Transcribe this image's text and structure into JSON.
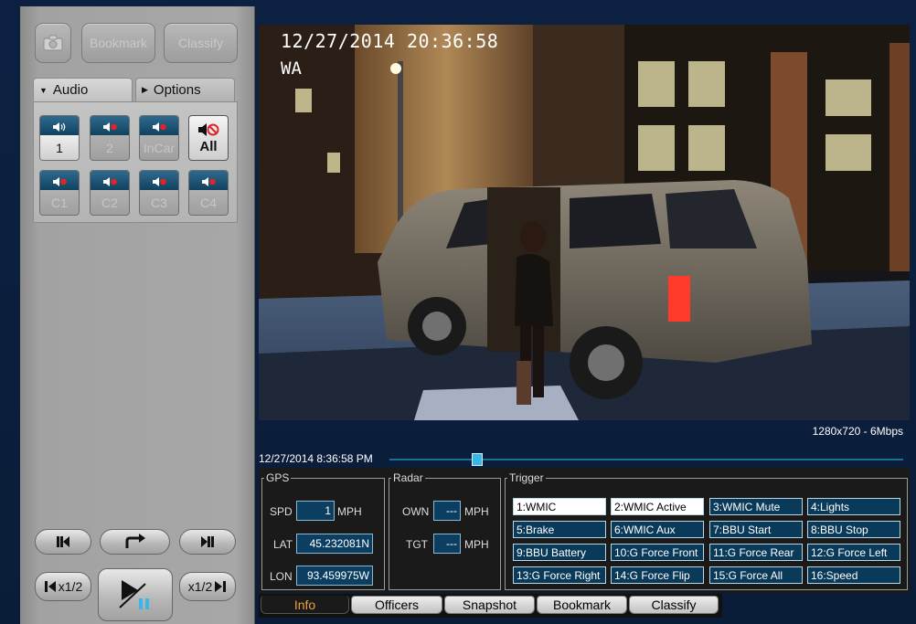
{
  "toolbar": {
    "bookmark_label": "Bookmark",
    "classify_label": "Classify"
  },
  "side_tabs": {
    "audio": "Audio",
    "options": "Options"
  },
  "audio_channels": {
    "ch1": "1",
    "ch2": "2",
    "incar": "InCar",
    "all": "All",
    "c1": "C1",
    "c2": "C2",
    "c3": "C3",
    "c4": "C4"
  },
  "playback": {
    "slow_back": "x1/2",
    "slow_fwd": "x1/2"
  },
  "video": {
    "timestamp_overlay": "12/27/2014 20:36:58",
    "plate_overlay": "WA",
    "resolution": "1280x720 - 6Mbps",
    "seek_time": "12/27/2014 8:36:58 PM",
    "seek_position": 0.17
  },
  "gps": {
    "legend": "GPS",
    "spd_label": "SPD",
    "spd_value": "1",
    "spd_unit": "MPH",
    "lat_label": "LAT",
    "lat_value": "45.232081N",
    "lon_label": "LON",
    "lon_value": "93.459975W"
  },
  "radar": {
    "legend": "Radar",
    "own_label": "OWN",
    "own_value": "---",
    "own_unit": "MPH",
    "tgt_label": "TGT",
    "tgt_value": "---",
    "tgt_unit": "MPH"
  },
  "trigger": {
    "legend": "Trigger",
    "items": [
      "1:WMIC",
      "2:WMIC Active",
      "3:WMIC Mute",
      "4:Lights",
      "5:Brake",
      "6:WMIC Aux",
      "7:BBU Start",
      "8:BBU Stop",
      "9:BBU Battery",
      "10:G Force Front",
      "11:G Force Rear",
      "12:G Force Left",
      "13:G Force Right",
      "14:G Force Flip",
      "15:G Force All",
      "16:Speed"
    ]
  },
  "bottom_tabs": [
    "Info",
    "Officers",
    "Snapshot",
    "Bookmark",
    "Classify"
  ],
  "colors": {
    "active_tab_text": "#e8a23c",
    "value_box": "#0c3e61",
    "seek_thumb": "#38b7e6"
  }
}
